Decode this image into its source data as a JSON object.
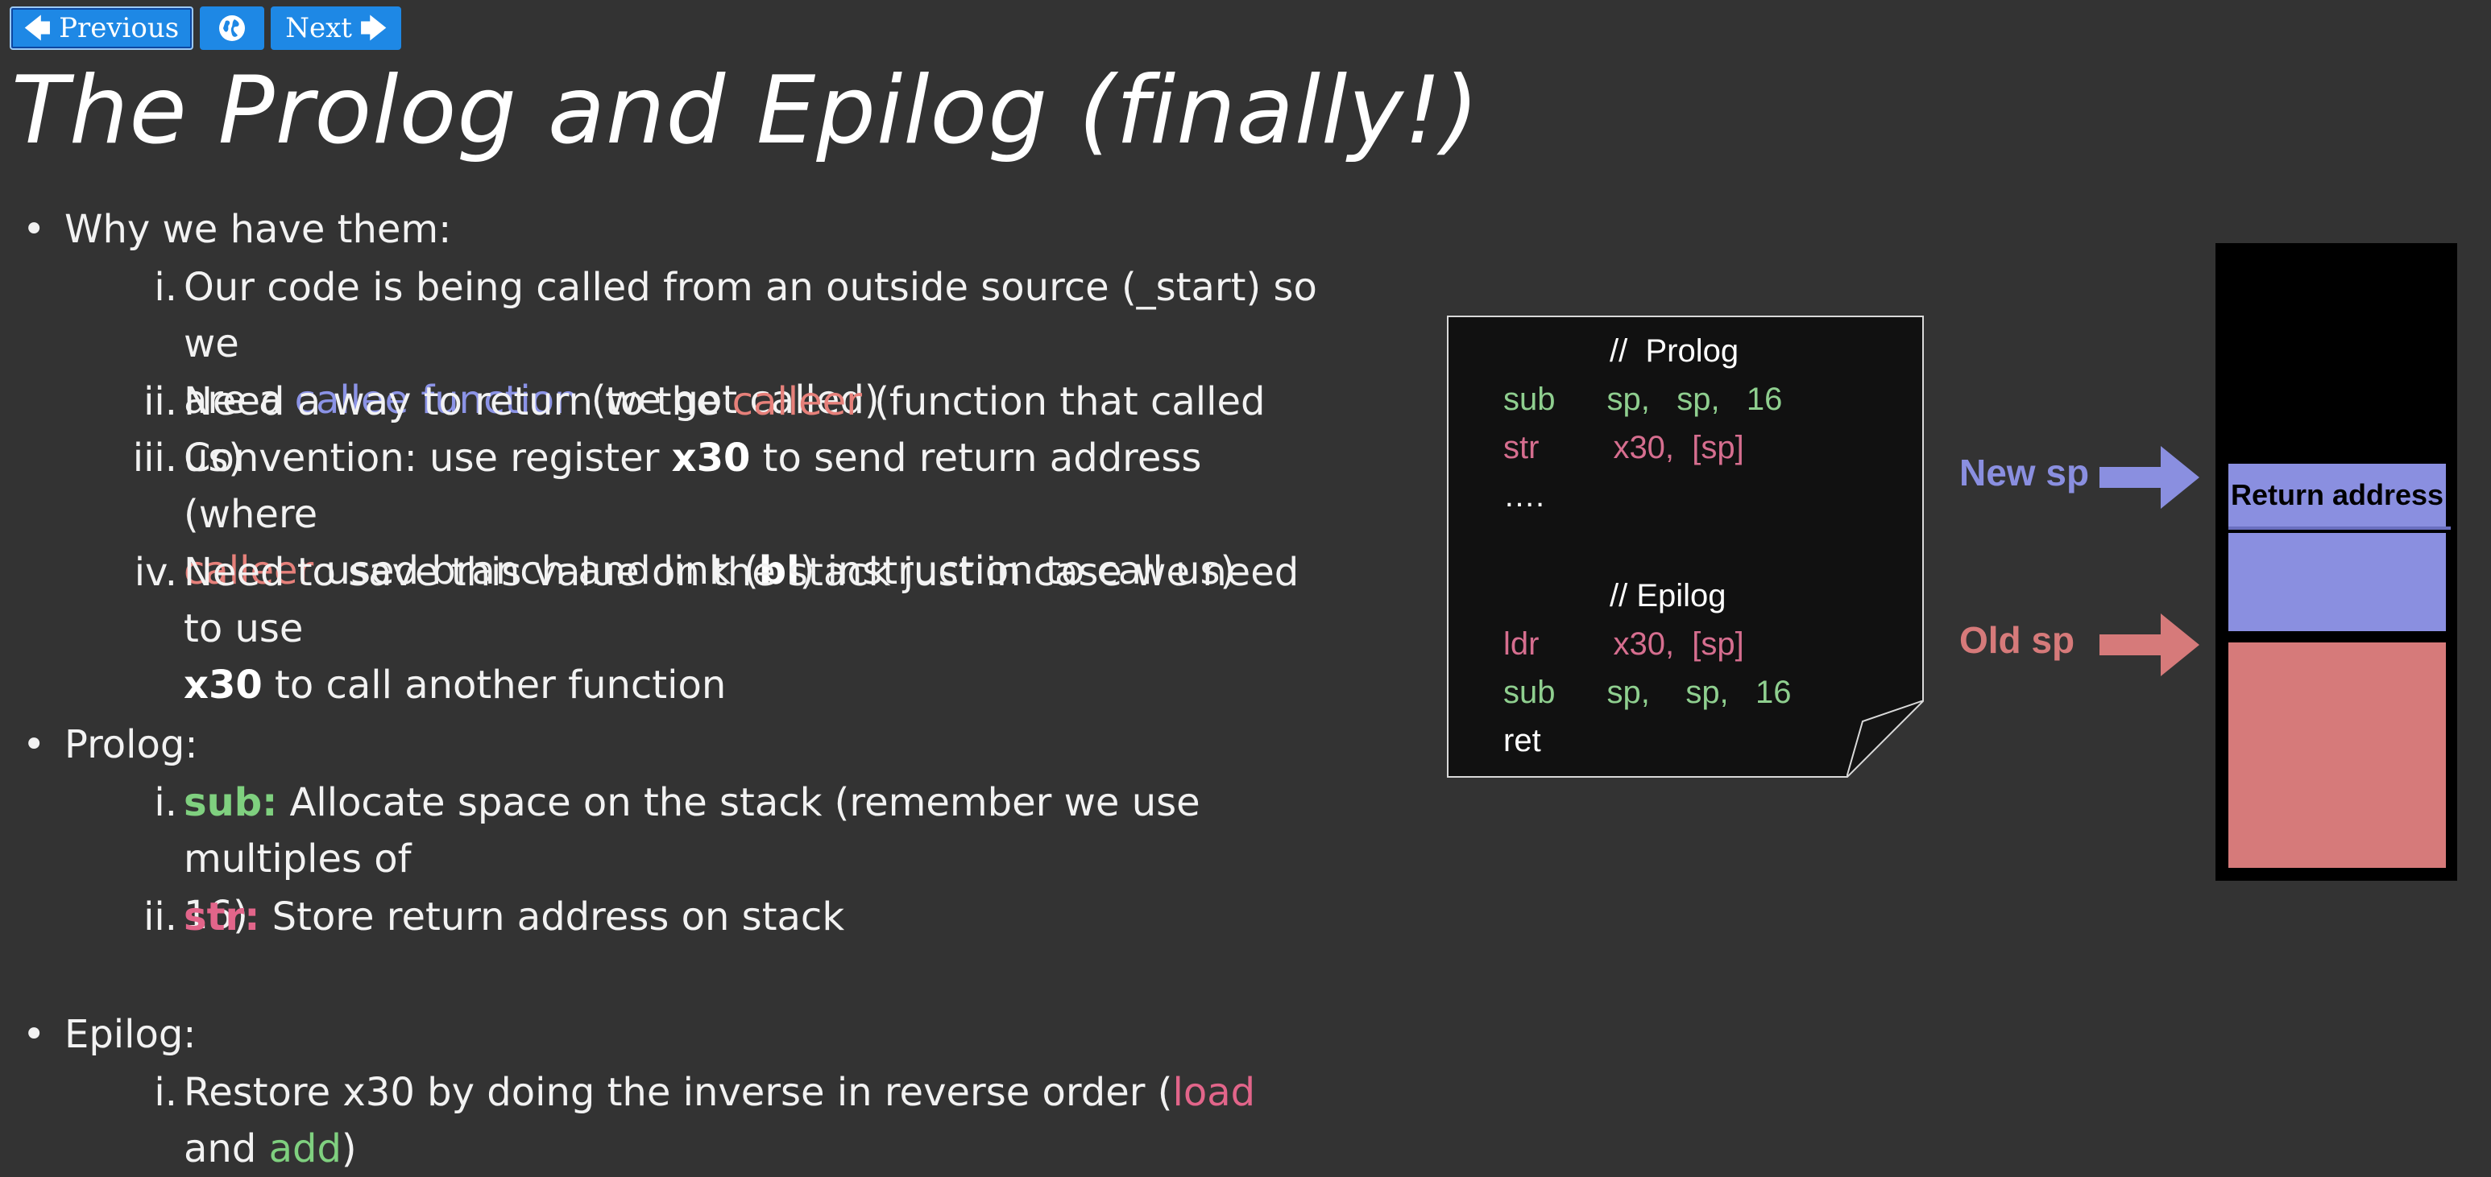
{
  "nav": {
    "previous_label": "Previous",
    "next_label": "Next",
    "previous_icon": "arrow-left-icon",
    "globe_icon": "globe-icon",
    "next_icon": "arrow-right-icon",
    "button_color": "#1e88e5"
  },
  "title": "The Prolog and Epilog (finally!)",
  "sections": {
    "why": {
      "heading": "Why we have them:",
      "items": [
        {
          "num": "i.",
          "l1a": "Our code is being called from an outside source (_start) so we",
          "l2a": "are a ",
          "l2b": "callee function",
          "l2c": " (we got called)"
        },
        {
          "num": "ii.",
          "a": "Need a way to return to the ",
          "b": "calleer",
          "c": " (function that called us)"
        },
        {
          "num": "iii.",
          "l1a": "Convention: use register ",
          "l1b": "x30",
          "l1c": " to send return address (where",
          "l2a": "calleer",
          "l2b": " used branch and link (",
          "l2c": "bl",
          "l2d": ") instruction to call us)"
        },
        {
          "num": "iv.",
          "l1": "Need to save this value on the stack just in case we need to use",
          "l2a": "x30",
          "l2b": " to call another function"
        }
      ]
    },
    "prolog": {
      "heading": "Prolog:",
      "items": [
        {
          "num": "i.",
          "l1a": "sub:",
          "l1b": " Allocate space on the stack (remember we use multiples of",
          "l2": "16)"
        },
        {
          "num": "ii.",
          "a": "str:",
          "b": " Store return address on stack"
        }
      ]
    },
    "epilog": {
      "heading": "Epilog:",
      "items": [
        {
          "num": "i.",
          "a": "Restore x30 by doing the inverse in reverse order (",
          "b": "load",
          "c": " and ",
          "d": "add",
          "e": ")"
        }
      ]
    }
  },
  "code_card": {
    "prolog_comment": "//  Prolog",
    "line1_op": "sub",
    "line1_args": "sp,   sp,   16",
    "line2_op": "str",
    "line2_args": "x30,  [sp]",
    "dots": "….",
    "epilog_comment": "// Epilog",
    "line3_op": "ldr",
    "line3_args": "x30,  [sp]",
    "line4_op": "sub",
    "line4_args": "sp,    sp,   16",
    "line5_op": "ret"
  },
  "stack_diagram": {
    "return_address": "Return address",
    "new_sp_label": "New sp",
    "old_sp_label": "Old sp",
    "new_sp_color": "#8a8fe0",
    "old_sp_color": "#d67a7a"
  }
}
